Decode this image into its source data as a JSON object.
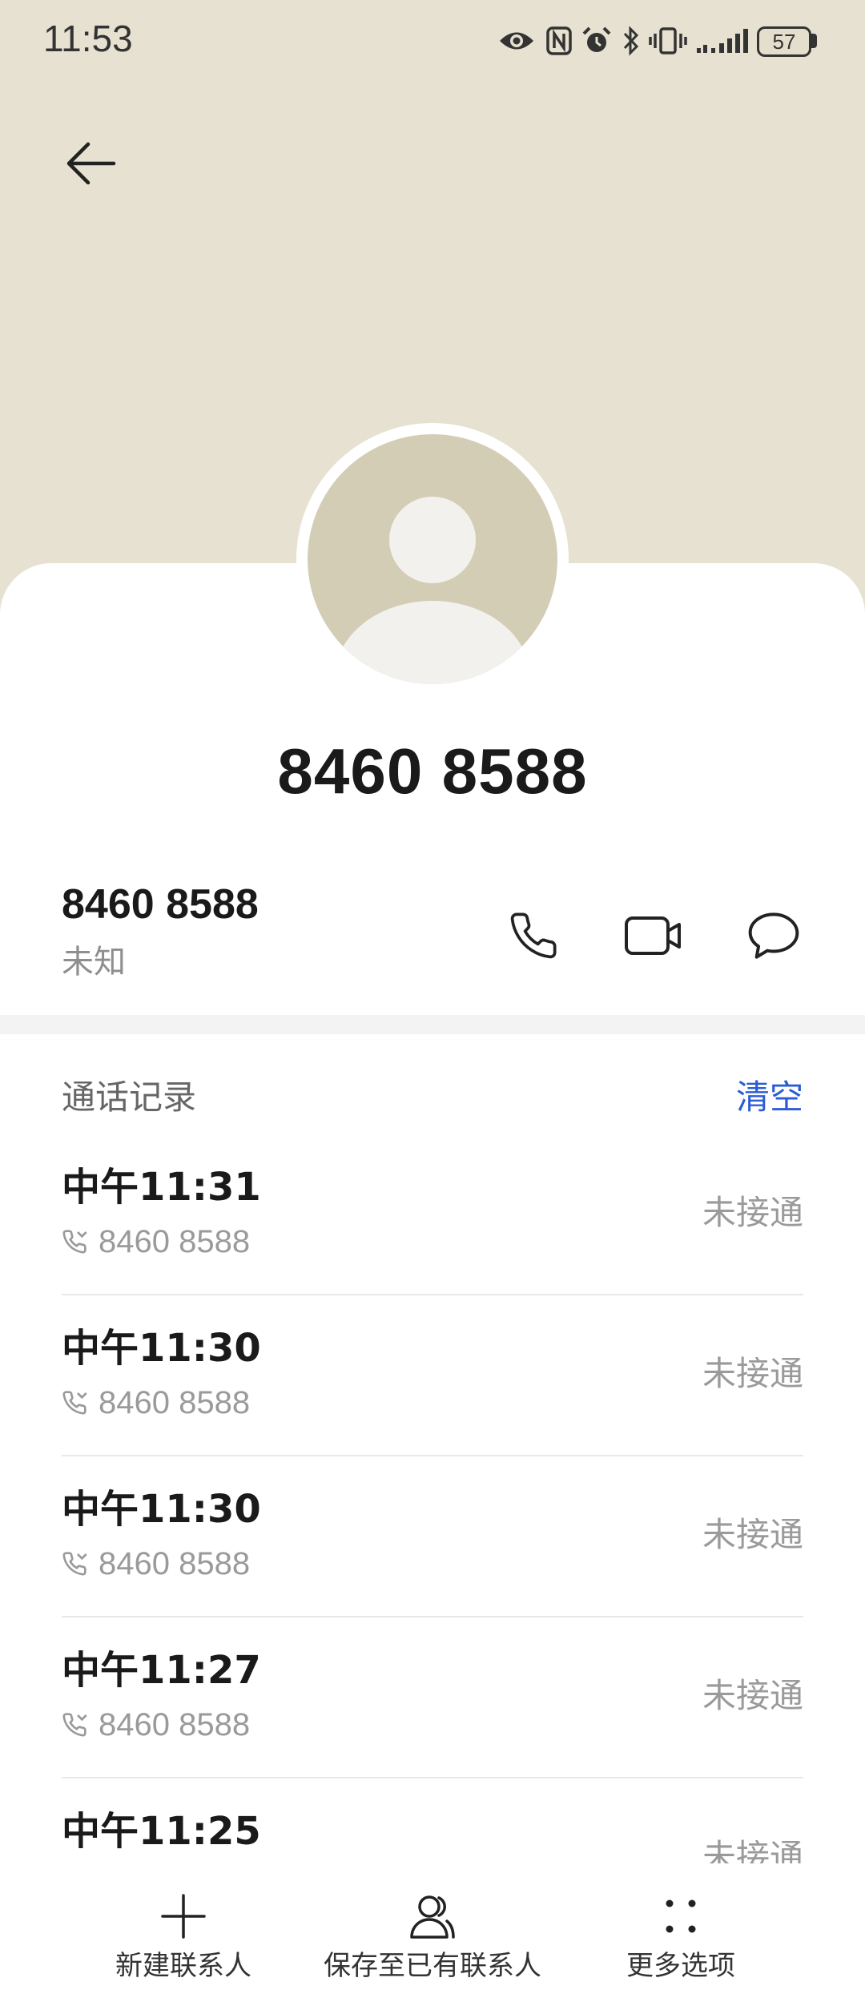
{
  "status_bar": {
    "time": "11:53",
    "battery": "57",
    "icons": [
      "eye-icon",
      "nfc-icon",
      "alarm-icon",
      "bluetooth-icon",
      "vibrate-icon",
      "signal-icon",
      "battery-icon"
    ]
  },
  "header": {
    "back_icon": "back-arrow-icon"
  },
  "contact": {
    "title": "8460 8588",
    "number": "8460 8588",
    "location": "未知",
    "actions": [
      "phone-icon",
      "video-call-icon",
      "message-icon"
    ]
  },
  "call_log": {
    "title": "通话记录",
    "clear_label": "清空",
    "entries": [
      {
        "time": "中午11:31",
        "number": "8460 8588",
        "status": "未接通"
      },
      {
        "time": "中午11:30",
        "number": "8460 8588",
        "status": "未接通"
      },
      {
        "time": "中午11:30",
        "number": "8460 8588",
        "status": "未接通"
      },
      {
        "time": "中午11:27",
        "number": "8460 8588",
        "status": "未接通"
      },
      {
        "time": "中午11:25",
        "status": "未接通"
      }
    ]
  },
  "bottom_nav": {
    "items": [
      {
        "label": "新建联系人",
        "icon": "plus-icon"
      },
      {
        "label": "保存至已有联系人",
        "icon": "add-to-existing-contact-icon"
      },
      {
        "label": "更多选项",
        "icon": "more-icon"
      }
    ]
  },
  "colors": {
    "header_bg": "#E6E1D0",
    "avatar_bg": "#D4CDB6",
    "accent": "#2B5DD6",
    "text_primary": "#1A1A1A",
    "text_secondary": "#8E8E8E"
  }
}
